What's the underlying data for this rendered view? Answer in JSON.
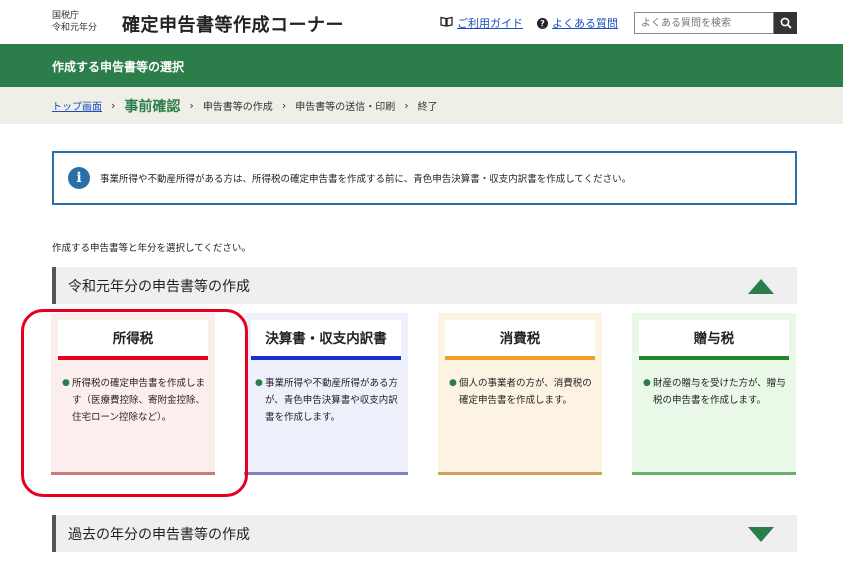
{
  "header": {
    "agency_line1": "国税庁",
    "agency_line2": "令和元年分",
    "title": "確定申告書等作成コーナー",
    "guide_link": "ご利用ガイド",
    "faq_link": "よくある質問",
    "search_placeholder": "よくある質問を検索",
    "guide_icon": "book-icon",
    "faq_icon": "question-icon",
    "search_icon": "search-icon"
  },
  "page_header": {
    "title": "作成する申告書等の選択"
  },
  "breadcrumb": {
    "items": [
      "トップ画面",
      "事前確認",
      "申告書等の作成",
      "申告書等の送信・印刷",
      "終了"
    ]
  },
  "info": {
    "icon": "info-icon",
    "text": "事業所得や不動産所得がある方は、所得税の確定申告書を作成する前に、青色申告決算書・収支内訳書を作成してください。"
  },
  "instruction": "作成する申告書等と年分を選択してください。",
  "sections": {
    "current": "令和元年分の申告書等の作成",
    "past": "過去の年分の申告書等の作成"
  },
  "cards": [
    {
      "title": "所得税",
      "desc": "所得税の確定申告書を作成します（医療費控除、寄附金控除、住宅ローン控除など）。",
      "bg": "#fdeeee",
      "accent": "#e6001f",
      "bottom": "#c97a7a"
    },
    {
      "title": "決算書・収支内訳書",
      "desc": "事業所得や不動産所得がある方が、青色申告決算書や収支内訳書を作成します。",
      "bg": "#eef0fb",
      "accent": "#1a2fcf",
      "bottom": "#7d84b8"
    },
    {
      "title": "消費税",
      "desc": "個人の事業者の方が、消費税の確定申告書を作成します。",
      "bg": "#fdf3e3",
      "accent": "#f0a020",
      "bottom": "#d3a060"
    },
    {
      "title": "贈与税",
      "desc": "財産の贈与を受けた方が、贈与税の申告書を作成します。",
      "bg": "#eaf8e8",
      "accent": "#1f8a2c",
      "bottom": "#6fae6a"
    }
  ],
  "colors": {
    "brand_green": "#2b7d4a",
    "link_blue": "#1a4fbf",
    "info_blue": "#2a6fa8",
    "highlight_red": "#e6001f"
  }
}
